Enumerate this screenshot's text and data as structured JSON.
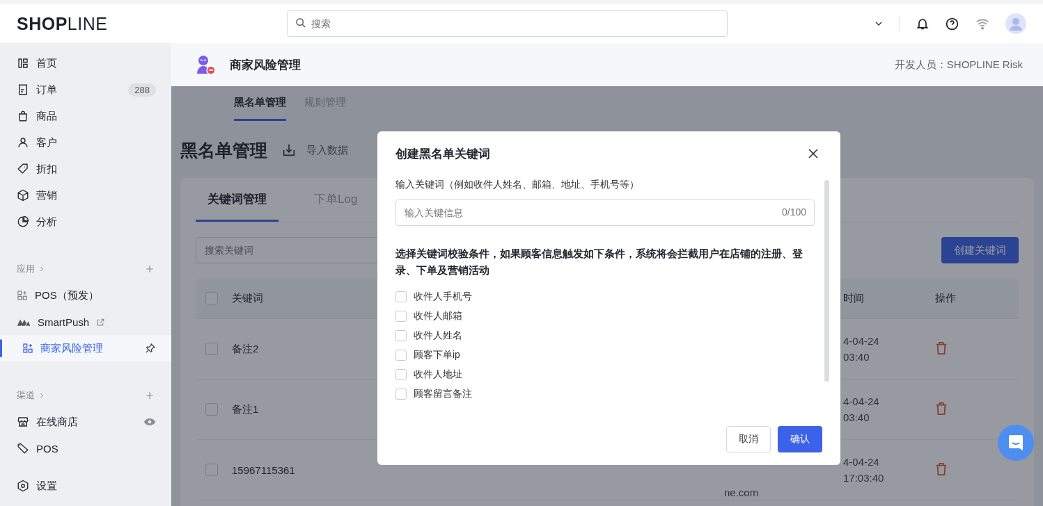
{
  "top_bar": {
    "logo": "**SHOP**LINE",
    "search": {
      "placeholder": "搜索"
    }
  },
  "sidebar": {
    "main": [
      {
        "label": "首页",
        "selected": false
      },
      {
        "label": "订单",
        "selected": false,
        "badge": "288"
      },
      {
        "label": "商品",
        "selected": false
      },
      {
        "label": "客户",
        "selected": false
      },
      {
        "label": "折扣",
        "selected": false
      },
      {
        "label": "营销",
        "selected": false
      },
      {
        "label": "分析",
        "selected": false
      }
    ],
    "apps": {
      "title": "应用",
      "items": [
        {
          "label": "POS（预发）",
          "selected": false,
          "kind": "app"
        },
        {
          "label": "SmartPush",
          "selected": false,
          "kind": "external"
        },
        {
          "label": "商家风险管理",
          "selected": true,
          "kind": "pinned"
        }
      ]
    },
    "channels": {
      "title": "渠道",
      "items": [
        {
          "label": "在线商店",
          "selected": false,
          "kind": "store"
        },
        {
          "label": "POS",
          "selected": false,
          "kind": "pos"
        }
      ]
    },
    "settings": {
      "label": "设置",
      "selected": false
    }
  },
  "app_header": {
    "title": "商家风险管理",
    "developer": "开发人员：SHOPLINE Risk"
  },
  "subtabs": [
    {
      "label": "黑名单管理",
      "selected": true
    },
    {
      "label": "规则管理",
      "selected": false
    }
  ],
  "page": {
    "title": "黑名单管理",
    "import": "导入数据"
  },
  "card": {
    "tabs": [
      {
        "label": "关键词管理",
        "selected": true
      },
      {
        "label": "下单Log",
        "selected": false
      }
    ],
    "search": {
      "placeholder": "搜索关键词"
    },
    "create_button": "创建关键词",
    "table": {
      "columns": [
        "关键词",
        "时间",
        "操作"
      ],
      "select_all": false,
      "rows": [
        {
          "checked": false,
          "keyword": "备注2",
          "time": [
            "4-04-24",
            "03:40"
          ]
        },
        {
          "checked": false,
          "keyword": "备注1",
          "time": [
            "4-04-24",
            "03:40"
          ]
        },
        {
          "checked": false,
          "keyword": "15967115361",
          "email": "ne.com",
          "time": [
            "4-04-24",
            "17:03:40"
          ]
        }
      ]
    }
  },
  "modal": {
    "title": "创建黑名单关键词",
    "field_label": "输入关键词（例如收件人姓名、邮箱、地址、手机号等）",
    "input": {
      "placeholder": "输入关键信息",
      "counter": "0/100"
    },
    "description": "选择关键词校验条件，如果顾客信息触发如下条件，系统将会拦截用户在店铺的注册、登录、下单及营销活动",
    "options": [
      {
        "label": "收件人手机号",
        "checked": false
      },
      {
        "label": "收件人邮箱",
        "checked": false
      },
      {
        "label": "收件人姓名",
        "checked": false
      },
      {
        "label": "顾客下单ip",
        "checked": false
      },
      {
        "label": "收件人地址",
        "checked": false
      },
      {
        "label": "顾客留言备注",
        "checked": false
      }
    ],
    "cancel": "取消",
    "confirm": "确认"
  }
}
